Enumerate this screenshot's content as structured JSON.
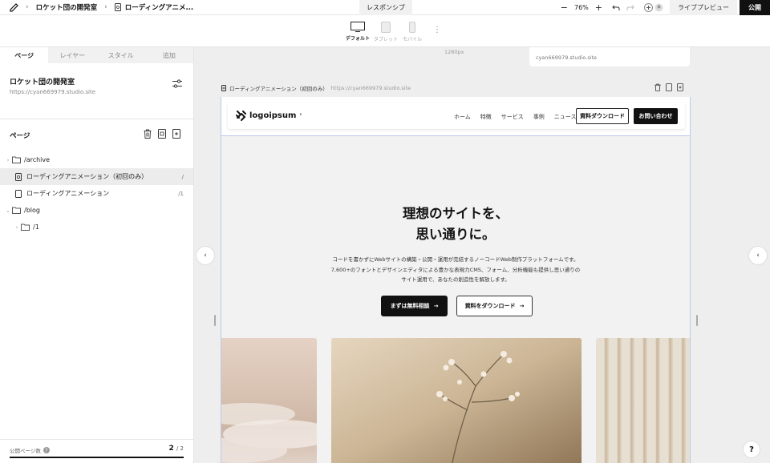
{
  "topbar": {
    "breadcrumb_project": "ロケット団の開発室",
    "breadcrumb_page": "ローディングアニメ...",
    "mode_tab": "レスポンシブ",
    "zoom": "76%",
    "live_preview": "ライブプレビュー",
    "publish": "公開"
  },
  "devices": {
    "default": "デフォルト",
    "tablet": "タブレット",
    "mobile": "モバイル"
  },
  "sidebar": {
    "tabs": [
      "ページ",
      "レイヤー",
      "スタイル",
      "追加"
    ],
    "project_title": "ロケット団の開発室",
    "project_url": "https://cyan669979.studio.site",
    "pages_title": "ページ",
    "tree": [
      {
        "name": "/archive",
        "slug": ""
      },
      {
        "name": "ローディングアニメーション（初回のみ）",
        "slug": "/"
      },
      {
        "name": "ローディングアニメーション",
        "slug": "/1"
      },
      {
        "name": "/blog",
        "slug": ""
      },
      {
        "name": "/1",
        "slug": ""
      }
    ],
    "footer_label": "公開ページ数",
    "footer_count": "2",
    "footer_total": "/ 2"
  },
  "canvas": {
    "ruler": "1280px",
    "prev_frame_url": "cyan669979.studio.site",
    "frame_title": "ローディングアニメーション（初回のみ）",
    "frame_url": "https://cyan669979.studio.site"
  },
  "site": {
    "logo": "logoipsum",
    "nav_links": [
      "ホーム",
      "特徴",
      "サービス",
      "事例",
      "ニュース"
    ],
    "btn_download": "資料ダウンロード",
    "btn_contact": "お問い合わせ",
    "hero_title_1": "理想のサイトを、",
    "hero_title_2": "思い通りに。",
    "hero_desc_1": "コードを書かずにWebサイトの構築・公開・運用が完結するノーコードWeb制作プラットフォームです。",
    "hero_desc_2": "7,600+のフォントとデザインエディタによる豊かな表現力CMS、フォーム、分析機能も提供し思い通りの",
    "hero_desc_3": "サイト運用で、あなたの創造性を解放します。",
    "hero_btn_primary": "まずは無料相談",
    "hero_btn_secondary": "資料をダウンロード"
  },
  "help": "?"
}
